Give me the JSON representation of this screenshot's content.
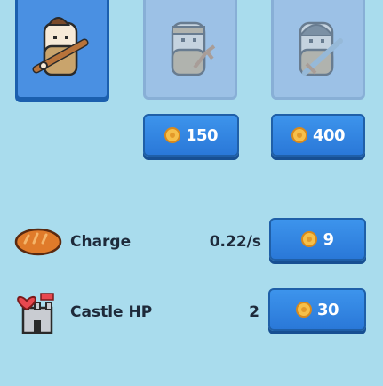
{
  "characters": [
    {
      "name": "club-fighter",
      "state": "selected"
    },
    {
      "name": "slingshot-fighter",
      "state": "locked",
      "price": "150"
    },
    {
      "name": "sword-fighter",
      "state": "locked",
      "price": "400"
    }
  ],
  "upgrades": [
    {
      "label": "Charge",
      "value": "0.22/s",
      "cost": "9",
      "icon": "bread-icon"
    },
    {
      "label": "Castle HP",
      "value": "2",
      "cost": "30",
      "icon": "castle-heart-icon"
    }
  ],
  "colors": {
    "background": "#a9dced",
    "button": "#2a78d8",
    "selected_card": "#4a90e2",
    "text": "#1e2a3a"
  }
}
